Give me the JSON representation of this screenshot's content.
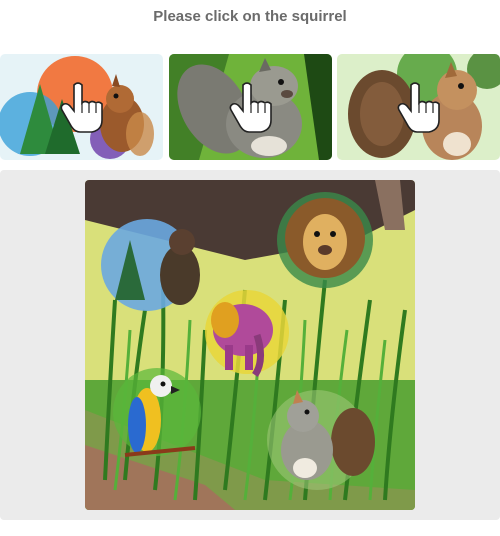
{
  "prompt": {
    "text": "Please click on the squirrel"
  },
  "examples": [
    {
      "label": "squirrel-example-1",
      "icon": "hand-pointer-icon"
    },
    {
      "label": "squirrel-example-2",
      "icon": "hand-pointer-icon"
    },
    {
      "label": "squirrel-example-3",
      "icon": "hand-pointer-icon"
    }
  ],
  "puzzle": {
    "animals": [
      "bear",
      "lion",
      "elephant",
      "parrot",
      "squirrel"
    ]
  },
  "footer": {
    "left_text": "",
    "right_text": ""
  },
  "colors": {
    "prompt_text": "#6b6b6b",
    "stage_background": "#ebebeb",
    "grass": "#4f9a2e",
    "sky": "#c9d56a"
  }
}
